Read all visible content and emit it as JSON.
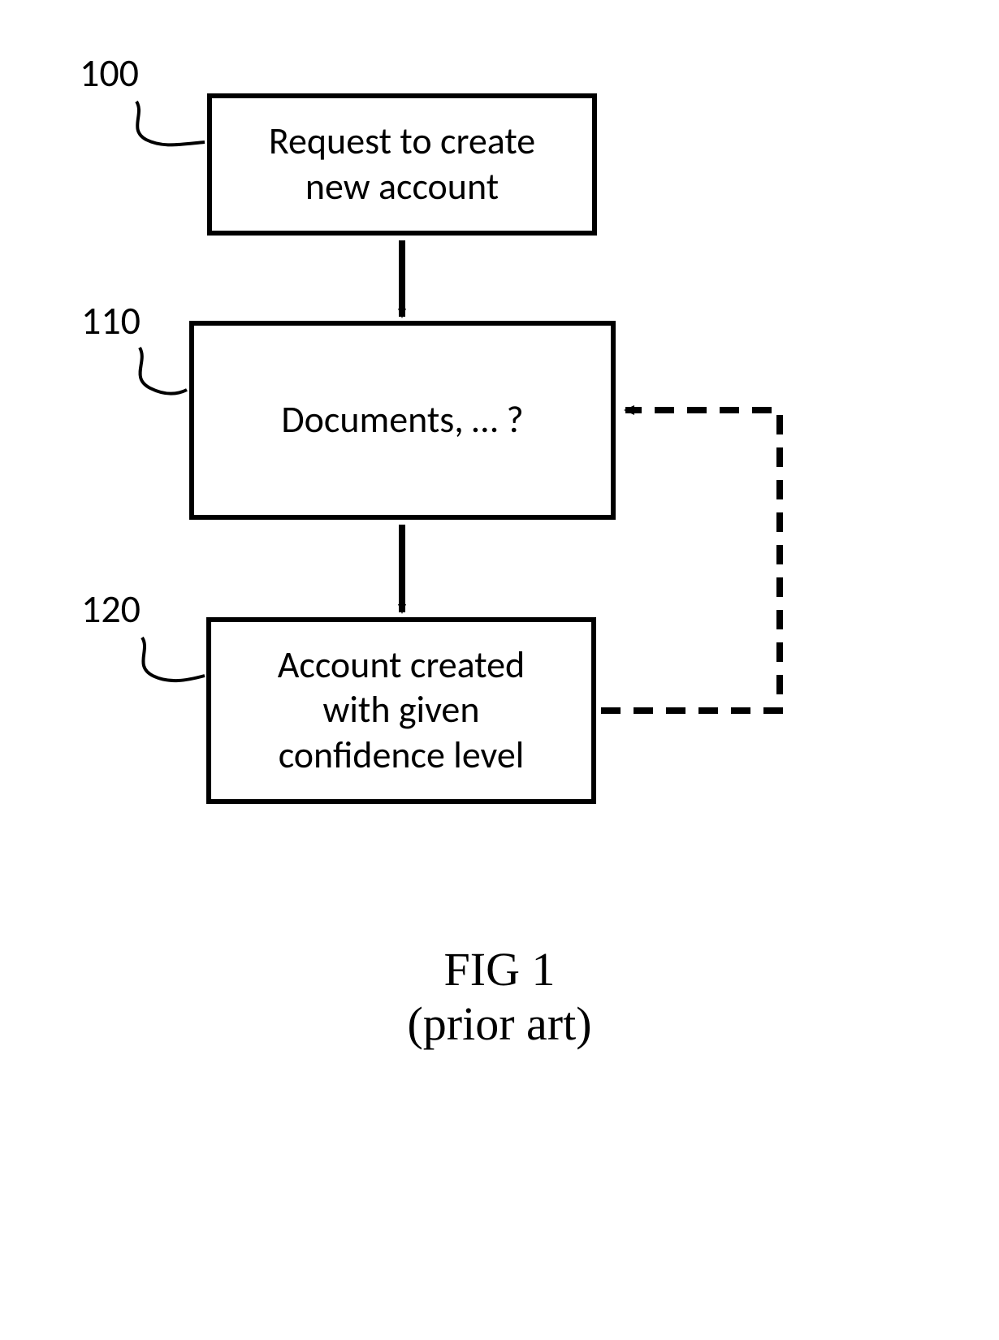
{
  "refs": {
    "r100": "100",
    "r110": "110",
    "r120": "120"
  },
  "boxes": {
    "b100": "Request to create\nnew account",
    "b110": "Documents, … ?",
    "b120": "Account created\nwith given\nconfidence level"
  },
  "caption": {
    "line1": "FIG 1",
    "line2": "(prior art)"
  }
}
